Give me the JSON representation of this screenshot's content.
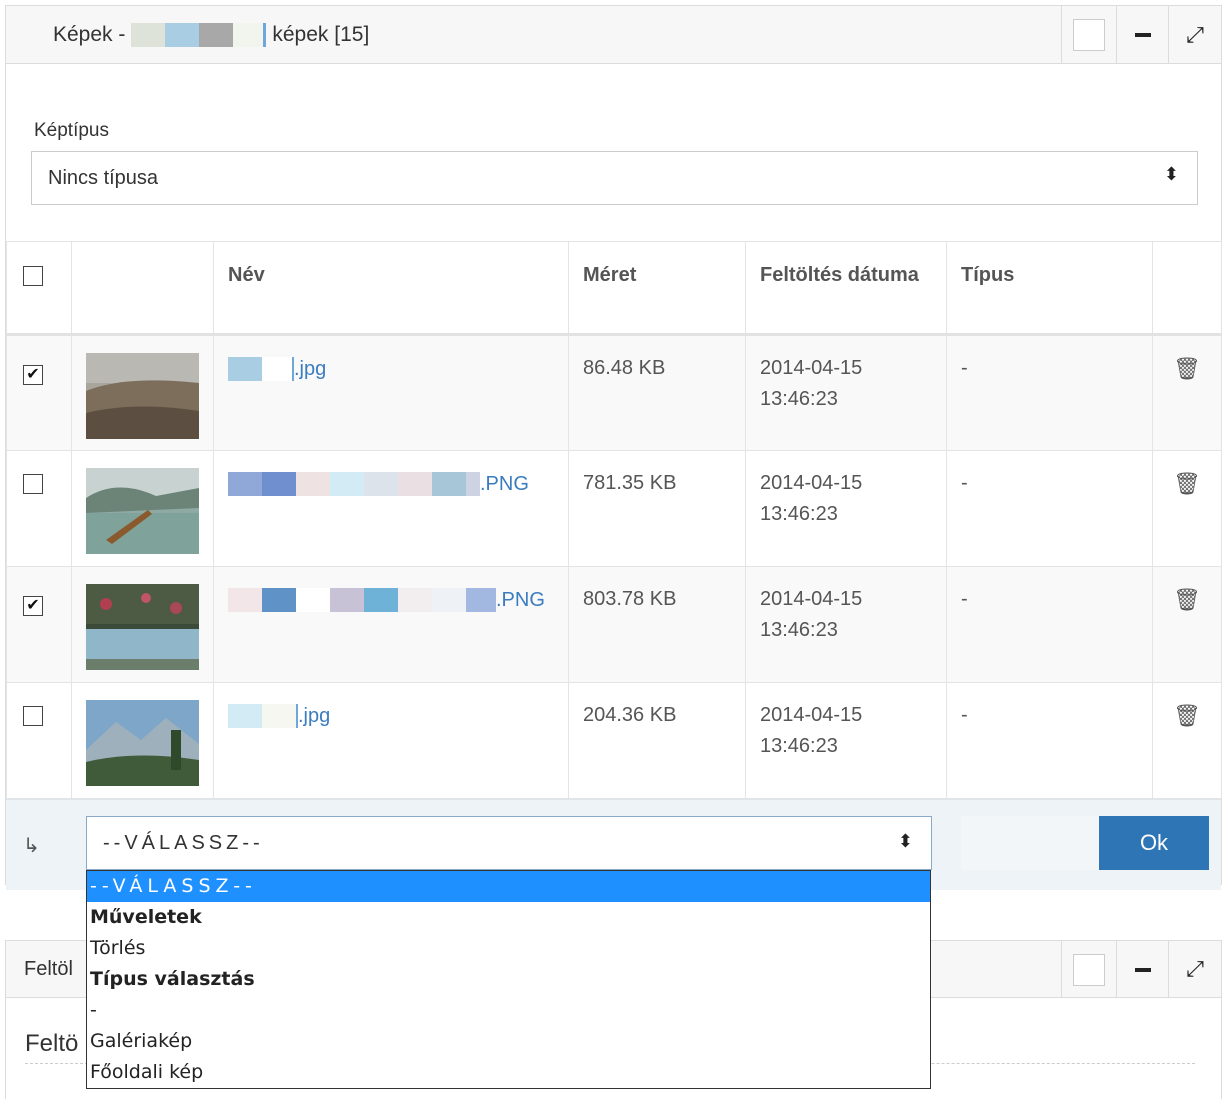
{
  "panel1": {
    "title_prefix": "Képek -",
    "title_suffix": "képek [15]"
  },
  "filter": {
    "label": "Képtípus",
    "value": "Nincs típusa"
  },
  "table": {
    "headers": [
      "Név",
      "Méret",
      "Feltöltés dátuma",
      "Típus"
    ],
    "rows": [
      {
        "name_suffix": ".jpg",
        "size": "86.48 KB",
        "date": "2014-04-15",
        "time": "13:46:23",
        "type": "-",
        "checked": true
      },
      {
        "name_suffix": ".PNG",
        "size": "781.35 KB",
        "date": "2014-04-15",
        "time": "13:46:23",
        "type": "-",
        "checked": false
      },
      {
        "name_suffix": ".PNG",
        "size": "803.78 KB",
        "date": "2014-04-15",
        "time": "13:46:23",
        "type": "-",
        "checked": true
      },
      {
        "name_suffix": ".jpg",
        "size": "204.36 KB",
        "date": "2014-04-15",
        "time": "13:46:23",
        "type": "-",
        "checked": false
      }
    ]
  },
  "action": {
    "select_value": "--VÁLASSZ--",
    "ok_label": "Ok"
  },
  "dropdown": {
    "options": [
      {
        "label": "--VÁLASSZ--",
        "kind": "selected"
      },
      {
        "label": "Műveletek",
        "kind": "group"
      },
      {
        "label": "Törlés",
        "kind": "option"
      },
      {
        "label": "Típus választás",
        "kind": "group"
      },
      {
        "label": "-",
        "kind": "option"
      },
      {
        "label": "Galériakép",
        "kind": "option"
      },
      {
        "label": "Főoldali kép",
        "kind": "option"
      }
    ]
  },
  "panel2": {
    "title": "Feltöl",
    "body_text": "Feltö"
  },
  "colors": {
    "link": "#3a7cc0",
    "button": "#2e75b6",
    "dropdown_highlight": "#1e90ff"
  }
}
